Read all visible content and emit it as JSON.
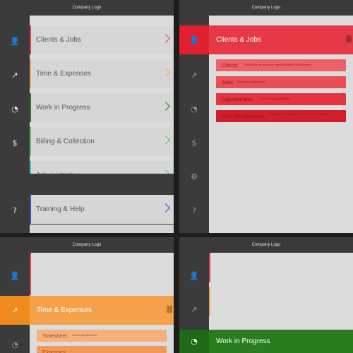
{
  "logo": "Company Logo",
  "menu": [
    {
      "label": "Clients & Jobs",
      "icon": "user-icon",
      "color": "#e53946"
    },
    {
      "label": "Time & Expenses",
      "icon": "chart-line-icon",
      "color": "#f5a14a"
    },
    {
      "label": "Work in Progress",
      "icon": "pie-chart-icon",
      "color": "#2a7d1f"
    },
    {
      "label": "Billing & Collection",
      "icon": "dollar-icon",
      "color": "#5cc45a"
    },
    {
      "label": "Administration",
      "icon": "gear-icon",
      "color": "#3fc3c6"
    },
    {
      "label": "Training & Help",
      "icon": "question-icon",
      "color": "#2f57c8"
    }
  ],
  "clients_submenu": [
    {
      "label": "Clients",
      "desc": "View clients, account plans, client feedback & client contacts"
    },
    {
      "label": "Jobs",
      "desc": "View jobs & budget status"
    },
    {
      "label": "Opportunities",
      "desc": "Create & view opportunities"
    },
    {
      "label": "Risk Management",
      "desc": "Propose a client or opportunity through risk management"
    }
  ],
  "time_submenu": [
    {
      "label": "Timesheet",
      "desc": "Submit your timesheet"
    },
    {
      "label": "Expenses",
      "desc": ""
    }
  ]
}
